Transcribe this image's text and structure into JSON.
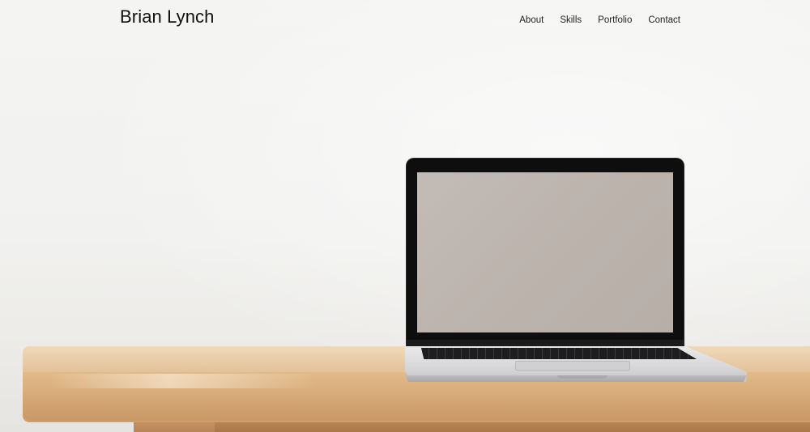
{
  "header": {
    "brand": "Brian Lynch",
    "nav": [
      {
        "label": "About"
      },
      {
        "label": "Skills"
      },
      {
        "label": "Portfolio"
      },
      {
        "label": "Contact"
      }
    ]
  },
  "hero": {
    "image_description_icon": "laptop-on-wooden-table-image"
  },
  "colors": {
    "background": "#f3f3f1",
    "text": "#111111",
    "wood": "#dfb787"
  }
}
